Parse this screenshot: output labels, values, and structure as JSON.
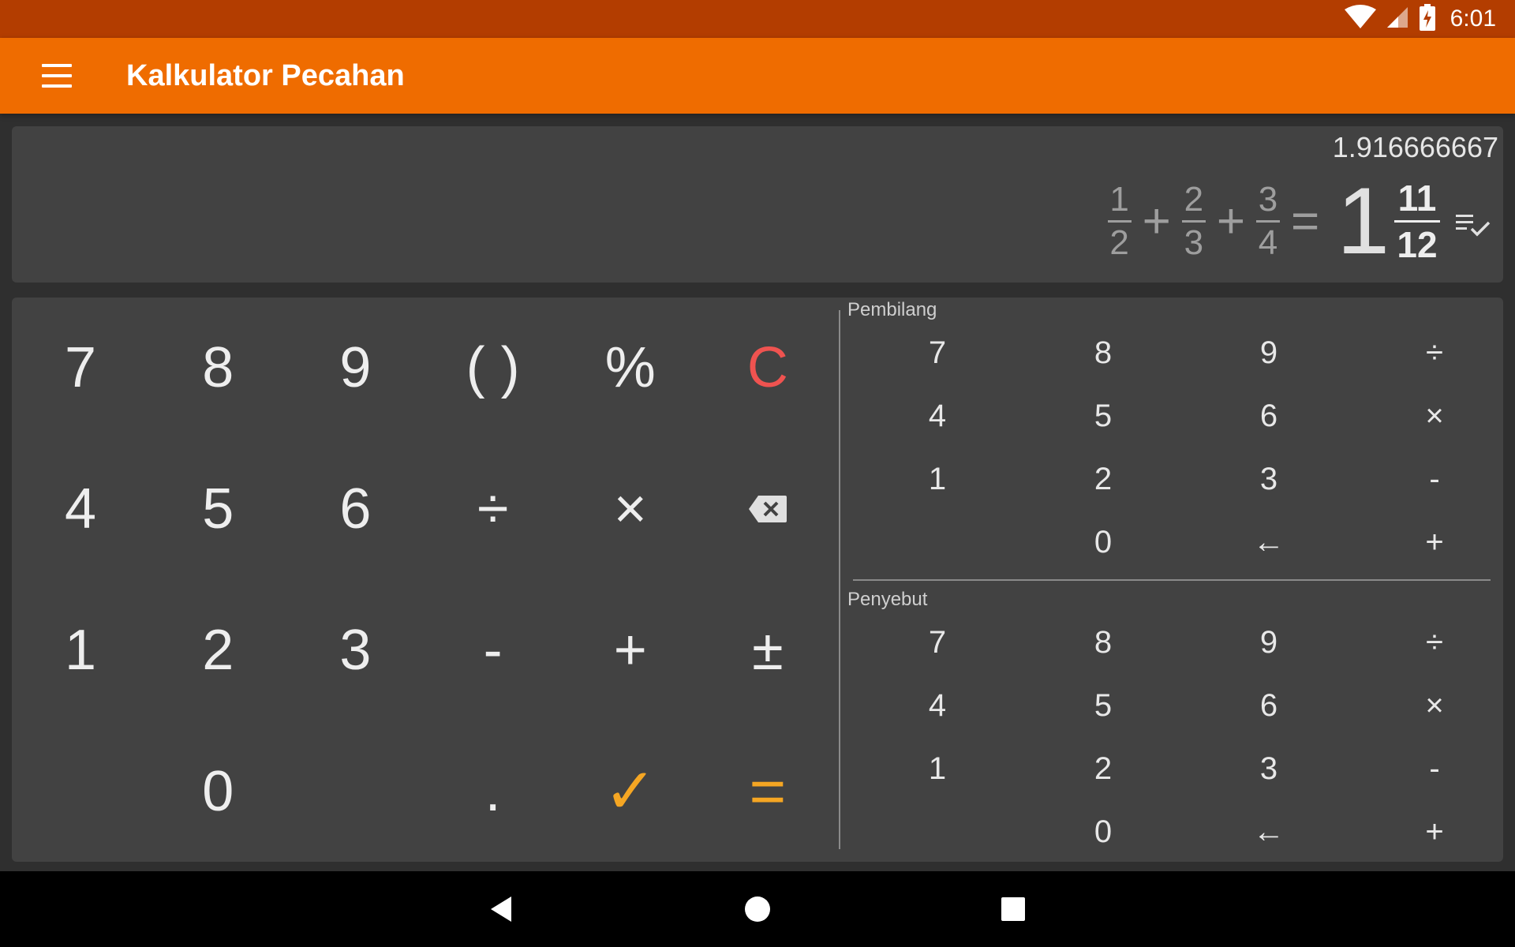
{
  "status_bar": {
    "time": "6:01",
    "icons": [
      "wifi-icon",
      "cell-signal-icon",
      "battery-charging-icon"
    ]
  },
  "app_bar": {
    "title": "Kalkulator Pecahan",
    "menu_icon": "hamburger-menu-icon",
    "background": "#ef6c00"
  },
  "display": {
    "decimal_result": "1.916666667",
    "expression": {
      "terms": [
        {
          "numerator": "1",
          "denominator": "2"
        },
        {
          "numerator": "2",
          "denominator": "3"
        },
        {
          "numerator": "3",
          "denominator": "4"
        }
      ],
      "operators": [
        "+",
        "+"
      ],
      "equals": "="
    },
    "result": {
      "whole": "1",
      "numerator": "11",
      "denominator": "12"
    },
    "history_icon": "history-list-check-icon"
  },
  "main_keypad": {
    "rows": [
      [
        "7",
        "8",
        "9",
        "( )",
        "%",
        "C"
      ],
      [
        "4",
        "5",
        "6",
        "÷",
        "×",
        "⌫"
      ],
      [
        "1",
        "2",
        "3",
        "-",
        "+",
        "±"
      ],
      [
        "",
        "0",
        "",
        ".",
        "✓",
        "="
      ]
    ]
  },
  "numerator_pad": {
    "label": "Pembilang",
    "rows": [
      [
        "7",
        "8",
        "9",
        "÷"
      ],
      [
        "4",
        "5",
        "6",
        "×"
      ],
      [
        "1",
        "2",
        "3",
        "-"
      ],
      [
        "",
        "0",
        "←",
        "+"
      ]
    ]
  },
  "denominator_pad": {
    "label": "Penyebut",
    "rows": [
      [
        "7",
        "8",
        "9",
        "÷"
      ],
      [
        "4",
        "5",
        "6",
        "×"
      ],
      [
        "1",
        "2",
        "3",
        "-"
      ],
      [
        "",
        "0",
        "←",
        "+"
      ]
    ]
  },
  "colors": {
    "status_bar": "#b33d00",
    "accent_orange": "#f5a623",
    "clear_red": "#ef5350",
    "panel": "#424242",
    "background": "#2f2f2f"
  },
  "nav_bar": {
    "icons": [
      "back-icon",
      "home-icon",
      "recents-icon"
    ]
  }
}
